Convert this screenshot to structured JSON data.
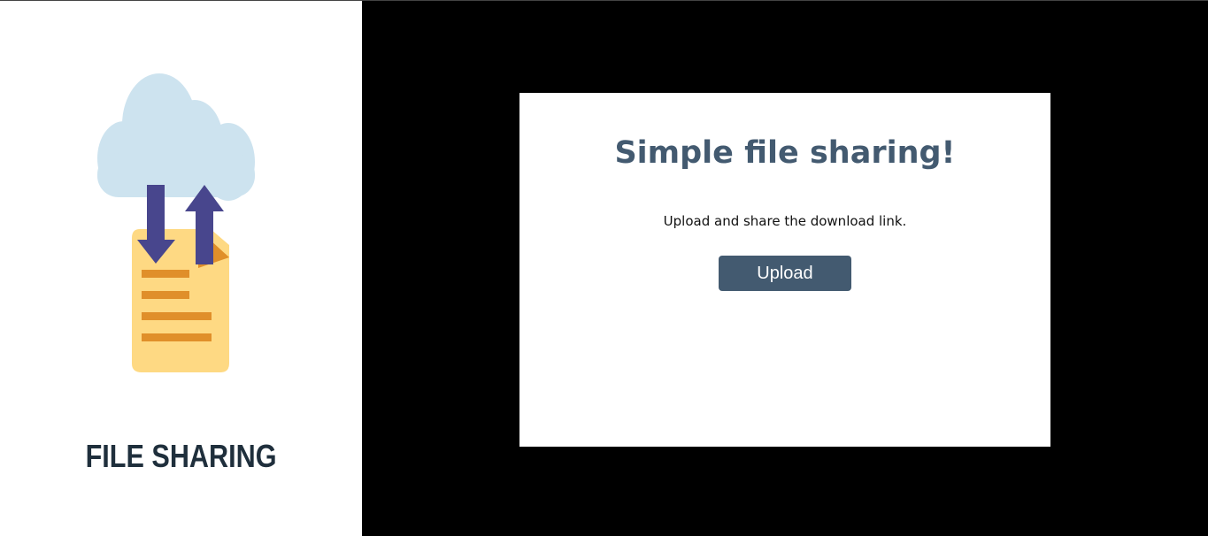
{
  "brand": {
    "title": "FILE SHARING"
  },
  "card": {
    "title": "Simple file sharing!",
    "subtitle": "Upload and share the download link.",
    "upload_label": "Upload"
  },
  "colors": {
    "accent": "#435a70",
    "cloud": "#cde3ef",
    "arrow": "#48468d",
    "document": "#fed983",
    "document_lines": "#e08f2a"
  }
}
